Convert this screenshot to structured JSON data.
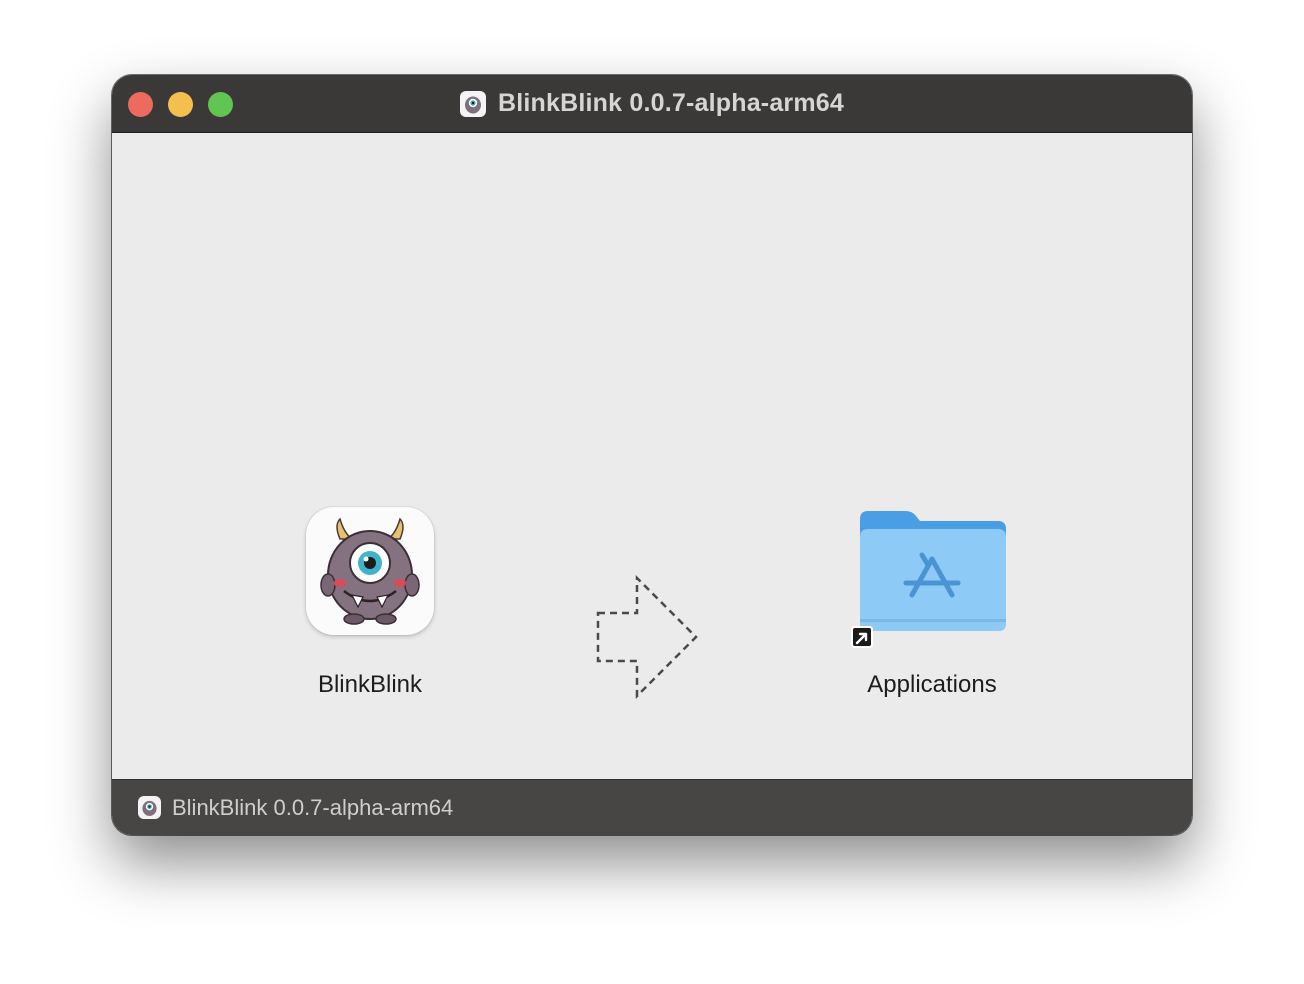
{
  "window": {
    "title": "BlinkBlink 0.0.7-alpha-arm64",
    "traffic_lights": {
      "close_color": "#ed6a5e",
      "minimize_color": "#f5bf4f",
      "zoom_color": "#61c554"
    }
  },
  "content": {
    "source_item": {
      "label": "BlinkBlink",
      "icon": "monster-app-icon"
    },
    "arrow_icon": "dashed-right-arrow-icon",
    "target_item": {
      "label": "Applications",
      "icon": "applications-folder-icon",
      "alias_badge": "alias-arrow-icon"
    }
  },
  "footer": {
    "volume_name": "BlinkBlink 0.0.7-alpha-arm64",
    "icon": "disk-image-icon"
  },
  "colors": {
    "titlebar": "#3b3938",
    "footer": "#474645",
    "content_background": "#ebebeb",
    "folder_blue": "#8ccaf5"
  }
}
